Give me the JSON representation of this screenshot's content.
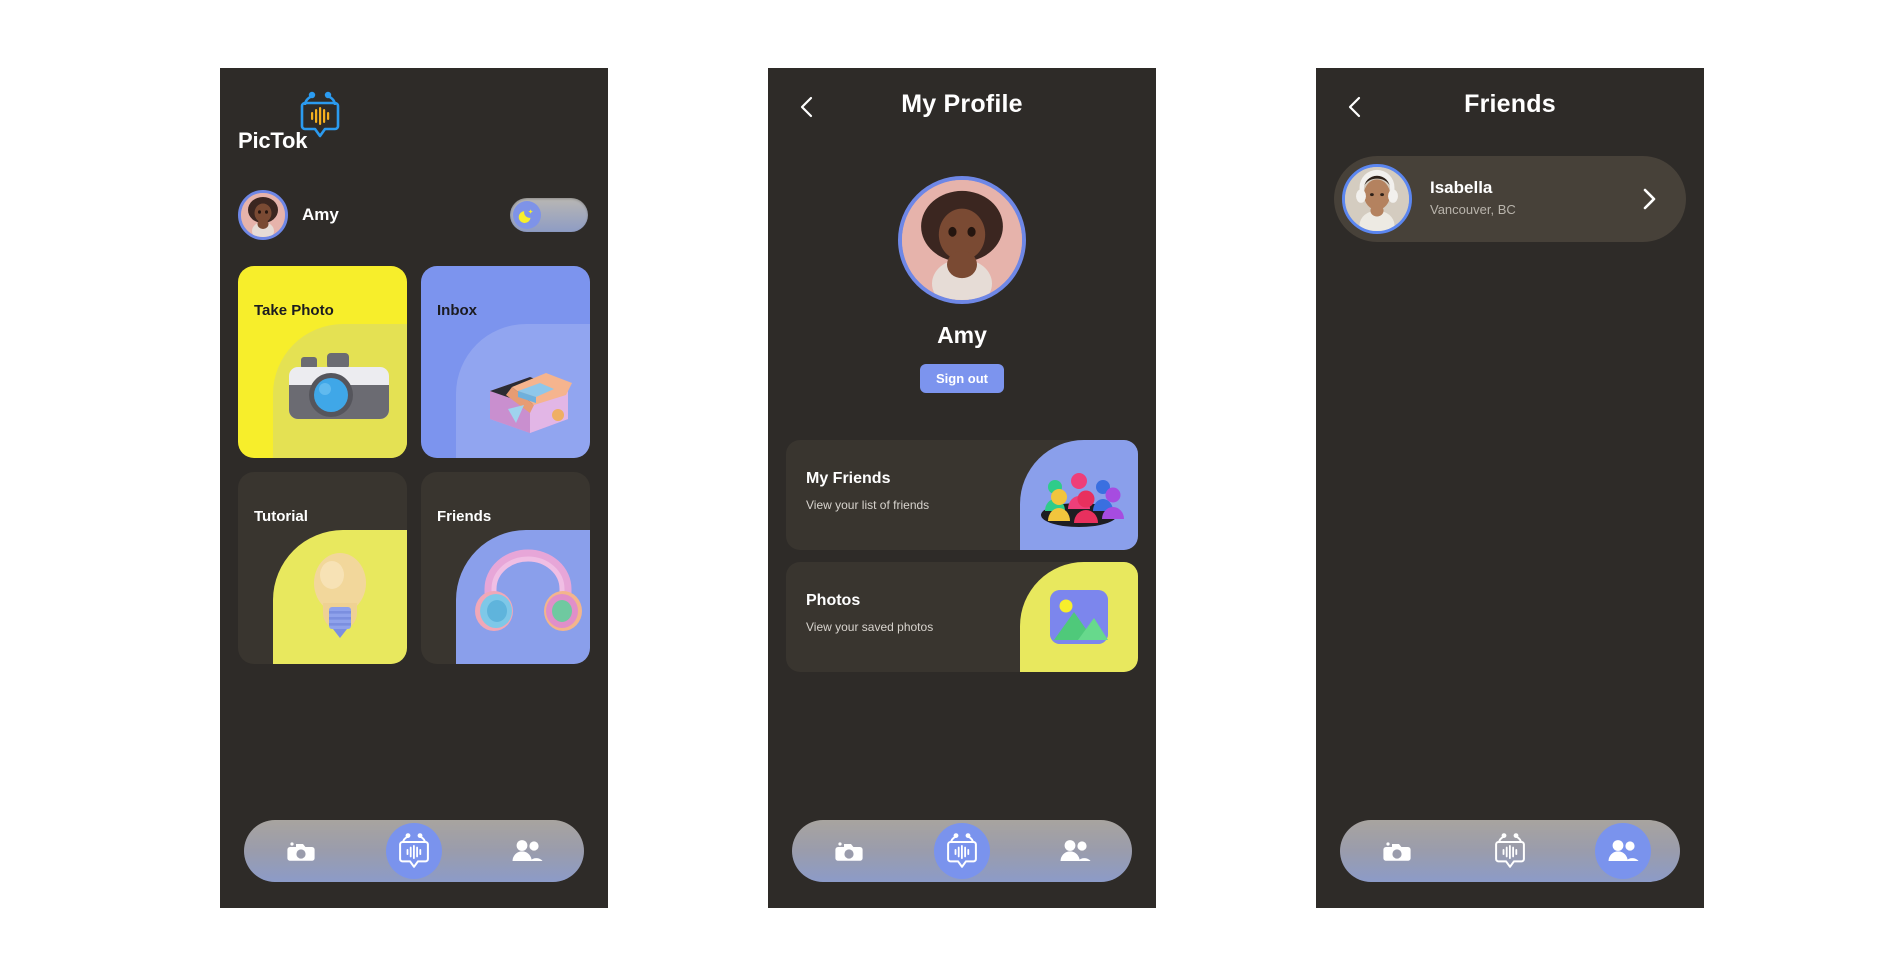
{
  "app": {
    "brand_name": "PicTok",
    "brand_logo_icon": "pictok-book-wave-logo"
  },
  "screens": {
    "home": {
      "user": {
        "name": "Amy",
        "avatar_icon": "avatar-amy"
      },
      "theme_toggle": {
        "icon": "moon-icon",
        "state": "dark"
      },
      "cards": [
        {
          "label": "Take Photo",
          "art_icon": "camera-3d-icon",
          "bg": "#F7EE2B",
          "text": "#1b1b20"
        },
        {
          "label": "Inbox",
          "art_icon": "open-box-3d-icon",
          "bg": "#7C94EE",
          "text": "#1b1b20"
        },
        {
          "label": "Tutorial",
          "art_icon": "lightbulb-3d-icon",
          "bg": "#39352F",
          "text": "#ffffff"
        },
        {
          "label": "Friends",
          "art_icon": "headphones-3d-icon",
          "bg": "#39352F",
          "text": "#ffffff"
        }
      ],
      "nav": [
        {
          "icon": "camera-icon",
          "active": false
        },
        {
          "icon": "pictok-book-wave-logo",
          "active": true
        },
        {
          "icon": "people-icon",
          "active": false
        }
      ]
    },
    "profile": {
      "title": "My Profile",
      "back_icon": "chevron-left-icon",
      "avatar_icon": "avatar-amy",
      "name": "Amy",
      "signout_label": "Sign out",
      "menu": [
        {
          "title": "My Friends",
          "subtitle": "View your list of friends",
          "art_icon": "group-people-3d-icon",
          "panel": "#8A9FEB"
        },
        {
          "title": "Photos",
          "subtitle": "View your saved photos",
          "art_icon": "image-3d-icon",
          "panel": "#E8E85E"
        }
      ],
      "nav": [
        {
          "icon": "camera-icon",
          "active": false
        },
        {
          "icon": "pictok-book-wave-logo",
          "active": true
        },
        {
          "icon": "people-icon",
          "active": false
        }
      ]
    },
    "friends": {
      "title": "Friends",
      "back_icon": "chevron-left-icon",
      "list": [
        {
          "name": "Isabella",
          "location": "Vancouver, BC",
          "avatar_icon": "avatar-isabella",
          "chevron_icon": "chevron-right-icon"
        }
      ],
      "nav": [
        {
          "icon": "camera-icon",
          "active": false
        },
        {
          "icon": "pictok-book-wave-logo",
          "active": false
        },
        {
          "icon": "people-icon",
          "active": true
        }
      ]
    }
  },
  "colors": {
    "phone_bg": "#2E2B28",
    "accent_blue": "#7C94EE",
    "accent_yellow": "#F7EE2B",
    "card_dark": "#39352F",
    "logo_blue": "#2B9BF0",
    "logo_yellow": "#F5B01E"
  }
}
